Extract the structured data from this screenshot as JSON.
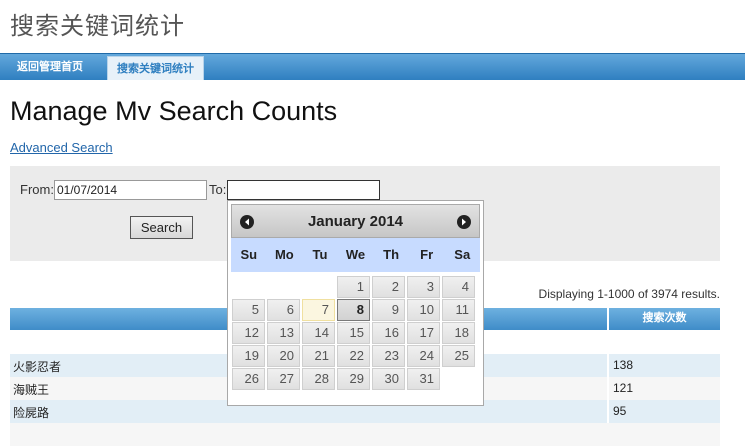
{
  "site": {
    "title": "搜索关键词统计"
  },
  "nav": {
    "items": [
      {
        "label": "返回管理首页",
        "active": false
      },
      {
        "label": "搜索关键词统计",
        "active": true
      }
    ]
  },
  "page": {
    "title": "Manage Mv Search Counts",
    "advanced_search_link": "Advanced Search"
  },
  "search": {
    "from_label": "From:",
    "from_value": "01/07/2014",
    "to_label": "To:",
    "to_value": "",
    "button_label": "Search"
  },
  "results": {
    "summary": "Displaying 1-1000 of 3974 results.",
    "column_count_header": "搜索次数",
    "rows": [
      {
        "keyword": "火影忍者",
        "count": "138"
      },
      {
        "keyword": "海贼王",
        "count": "121"
      },
      {
        "keyword": "险屍路",
        "count": "95"
      }
    ]
  },
  "datepicker": {
    "month_label": "January 2014",
    "weekdays": [
      "Su",
      "Mo",
      "Tu",
      "We",
      "Th",
      "Fr",
      "Sa"
    ],
    "leading_blanks": 3,
    "days": [
      "1",
      "2",
      "3",
      "4",
      "5",
      "6",
      "7",
      "8",
      "9",
      "10",
      "11",
      "12",
      "13",
      "14",
      "15",
      "16",
      "17",
      "18",
      "19",
      "20",
      "21",
      "22",
      "23",
      "24",
      "25",
      "26",
      "27",
      "28",
      "29",
      "30",
      "31"
    ],
    "today_day": "7",
    "hover_day": "8",
    "prev_icon": "prev-circle-icon",
    "next_icon": "next-circle-icon"
  }
}
